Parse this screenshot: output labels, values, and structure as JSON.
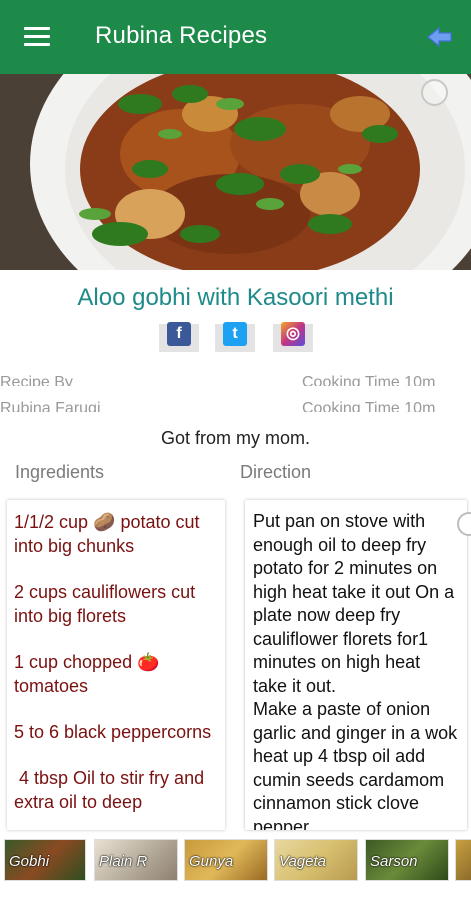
{
  "app": {
    "title": "Rubina Recipes",
    "bar_color": "#1d8a4a",
    "icons": {
      "menu": "hamburger-menu-icon",
      "back": "back-arrow-icon"
    }
  },
  "recipe": {
    "title": "Aloo gobhi with Kasoori methi",
    "share": [
      {
        "name": "facebook-icon",
        "glyph": "f",
        "color": "#3b5998"
      },
      {
        "name": "twitter-icon",
        "glyph": "t",
        "color": "#1da1f2"
      },
      {
        "name": "instagram-icon",
        "glyph": "◎",
        "color": "#c13584"
      }
    ],
    "meta": {
      "recipe_by_label": "Recipe By",
      "recipe_by_value": "Rubina Faruqi",
      "cooking_time_label": "Cooking Time 10m",
      "cooking_time_value": "Cooking Time 10m"
    },
    "note": "Got from my mom.",
    "ingredients_heading": "Ingredients",
    "direction_heading": "Direction",
    "ingredients": [
      "1/1/2 cup 🥔 potato cut into big chunks",
      "2 cups cauliflowers cut into big florets",
      "1 cup chopped 🍅 tomatoes",
      "5 to 6 black peppercorns",
      " 4 tbsp Oil to stir fry and extra oil to deep"
    ],
    "direction": [
      "Put pan on stove with enough oil to deep fry potato for 2 minutes on high heat take it out On a plate now deep fry cauliflower florets for1 minutes on high heat take it out.",
      "Make a paste of onion garlic and ginger in a  wok heat up 4 tbsp oil add cumin seeds cardamom cinnamon stick clove pepper"
    ]
  },
  "related": [
    {
      "label": "Gobhi"
    },
    {
      "label": "Plain R"
    },
    {
      "label": "Gunya"
    },
    {
      "label": "Vageta"
    },
    {
      "label": "Sarson"
    },
    {
      "label": ""
    }
  ]
}
